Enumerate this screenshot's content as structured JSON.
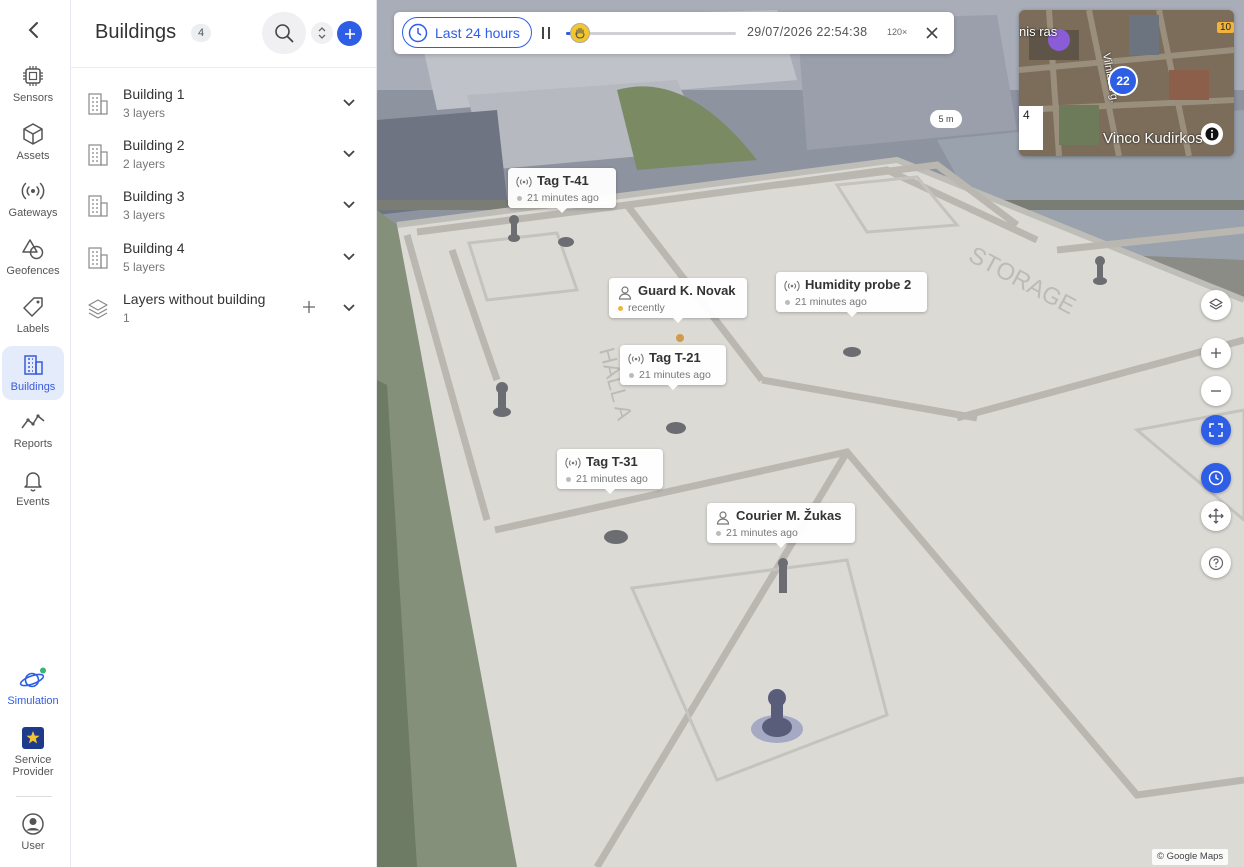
{
  "rail": {
    "items": [
      {
        "label": "Sensors"
      },
      {
        "label": "Assets"
      },
      {
        "label": "Gateways"
      },
      {
        "label": "Geofences"
      },
      {
        "label": "Labels"
      },
      {
        "label": "Buildings"
      },
      {
        "label": "Reports"
      },
      {
        "label": "Events"
      },
      {
        "label": "Simulation"
      },
      {
        "label": "Service Provider"
      },
      {
        "label": "User"
      }
    ],
    "active": "Buildings",
    "accent": "#2e5ee6"
  },
  "panel": {
    "title": "Buildings",
    "count": "4",
    "buildings": [
      {
        "name": "Building 1",
        "layers": "3 layers"
      },
      {
        "name": "Building 2",
        "layers": "2 layers"
      },
      {
        "name": "Building 3",
        "layers": "3 layers"
      },
      {
        "name": "Building 4",
        "layers": "5 layers"
      }
    ],
    "unassigned": {
      "name": "Layers without building",
      "count": "1"
    }
  },
  "timebar": {
    "range_label": "Last 24 hours",
    "timestamp": "29/07/2026 22:54:38",
    "speed": "120×",
    "progress": 0.08
  },
  "minimap": {
    "cluster_count": "22",
    "street_label": "Vilniaus g.",
    "place_label": "Vinco Kudirkos",
    "edge_text_top": "nis ras",
    "edge_text_left": "4",
    "corner_count": "10"
  },
  "scale": "5 m",
  "markers": [
    {
      "name": "Tag T-41",
      "time": "21 minutes ago",
      "kind": "sensor"
    },
    {
      "name": "Guard K. Novak",
      "time": "recently",
      "kind": "person"
    },
    {
      "name": "Humidity probe 2",
      "time": "21 minutes ago",
      "kind": "sensor"
    },
    {
      "name": "Tag T-21",
      "time": "21 minutes ago",
      "kind": "sensor"
    },
    {
      "name": "Tag T-31",
      "time": "21 minutes ago",
      "kind": "sensor"
    },
    {
      "name": "Courier M. Žukas",
      "time": "21 minutes ago",
      "kind": "person"
    }
  ],
  "floor_labels": {
    "storage": "STORAGE",
    "hall": "HALL A"
  },
  "attribution": "© Google Maps"
}
